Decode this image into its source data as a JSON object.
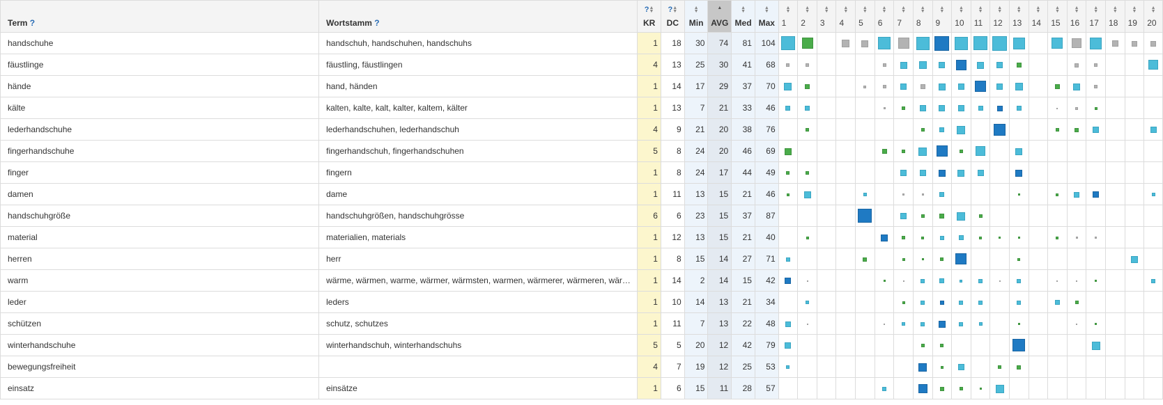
{
  "headers": {
    "term": "Term",
    "stem": "Wortstamm",
    "help": "?",
    "kr": "KR",
    "dc": "DC",
    "min": "Min",
    "avg": "AVG",
    "med": "Med",
    "max": "Max",
    "positions": [
      "1",
      "2",
      "3",
      "4",
      "5",
      "6",
      "7",
      "8",
      "9",
      "10",
      "11",
      "12",
      "13",
      "14",
      "15",
      "16",
      "17",
      "18",
      "19",
      "20"
    ]
  },
  "colors": {
    "gray": "#b3b3b3",
    "green": "#4aac4a",
    "light": "#4cbcd9",
    "dark": "#1f7ac3",
    "kr_bg": "#fcf6cd",
    "stat_bg": "#edf4fb"
  },
  "rows": [
    {
      "term": "handschuhe",
      "stem": "handschuh, handschuhen, handschuhs",
      "kr": "1",
      "dc": "18",
      "min": "30",
      "avg": "74",
      "med": "81",
      "max": "104",
      "cells": [
        [
          "light",
          20
        ],
        [
          "green",
          16
        ],
        null,
        [
          "gray",
          11
        ],
        [
          "gray",
          10
        ],
        [
          "light",
          18
        ],
        [
          "gray",
          16
        ],
        [
          "light",
          19
        ],
        [
          "dark",
          21
        ],
        [
          "light",
          19
        ],
        [
          "light",
          20
        ],
        [
          "light",
          21
        ],
        [
          "light",
          17
        ],
        null,
        [
          "light",
          16
        ],
        [
          "gray",
          14
        ],
        [
          "light",
          17
        ],
        [
          "gray",
          9
        ],
        [
          "gray",
          8
        ],
        [
          "gray",
          8
        ]
      ]
    },
    {
      "term": "fäustlinge",
      "stem": "fäustling, fäustlingen",
      "kr": "4",
      "dc": "13",
      "min": "25",
      "avg": "30",
      "med": "41",
      "max": "68",
      "cells": [
        [
          "gray",
          5
        ],
        [
          "gray",
          5
        ],
        null,
        null,
        null,
        [
          "gray",
          5
        ],
        [
          "light",
          10
        ],
        [
          "light",
          11
        ],
        [
          "light",
          9
        ],
        [
          "dark",
          15
        ],
        [
          "light",
          10
        ],
        [
          "light",
          9
        ],
        [
          "green",
          7
        ],
        null,
        null,
        [
          "gray",
          6
        ],
        [
          "gray",
          5
        ],
        null,
        null,
        [
          "light",
          14
        ]
      ]
    },
    {
      "term": "hände",
      "stem": "hand, händen",
      "kr": "1",
      "dc": "14",
      "min": "17",
      "avg": "29",
      "med": "37",
      "max": "70",
      "cells": [
        [
          "light",
          11
        ],
        [
          "green",
          7
        ],
        null,
        null,
        [
          "gray",
          4
        ],
        [
          "gray",
          5
        ],
        [
          "light",
          9
        ],
        [
          "gray",
          7
        ],
        [
          "light",
          10
        ],
        [
          "light",
          9
        ],
        [
          "dark",
          16
        ],
        [
          "light",
          9
        ],
        [
          "light",
          11
        ],
        null,
        [
          "green",
          7
        ],
        [
          "light",
          10
        ],
        [
          "gray",
          5
        ],
        null,
        null,
        null
      ]
    },
    {
      "term": "kälte",
      "stem": "kalten, kalte, kalt, kalter, kaltem, kälter",
      "kr": "1",
      "dc": "13",
      "min": "7",
      "avg": "21",
      "med": "33",
      "max": "46",
      "cells": [
        [
          "light",
          7
        ],
        [
          "light",
          7
        ],
        null,
        null,
        null,
        [
          "gray",
          3
        ],
        [
          "green",
          5
        ],
        [
          "light",
          9
        ],
        [
          "light",
          9
        ],
        [
          "light",
          9
        ],
        [
          "light",
          7
        ],
        [
          "dark",
          8
        ],
        [
          "light",
          7
        ],
        null,
        [
          "gray",
          2
        ],
        [
          "gray",
          4
        ],
        [
          "green",
          4
        ],
        null,
        null,
        null
      ]
    },
    {
      "term": "lederhandschuhe",
      "stem": "lederhandschuhen, lederhandschuh",
      "kr": "4",
      "dc": "9",
      "min": "21",
      "avg": "20",
      "med": "38",
      "max": "76",
      "cells": [
        null,
        [
          "green",
          5
        ],
        null,
        null,
        null,
        null,
        null,
        [
          "green",
          5
        ],
        [
          "light",
          7
        ],
        [
          "light",
          12
        ],
        null,
        [
          "dark",
          17
        ],
        null,
        null,
        [
          "green",
          5
        ],
        [
          "green",
          6
        ],
        [
          "light",
          9
        ],
        null,
        null,
        [
          "light",
          9
        ]
      ]
    },
    {
      "term": "fingerhandschuhe",
      "stem": "fingerhandschuh, fingerhandschuhen",
      "kr": "5",
      "dc": "8",
      "min": "24",
      "avg": "20",
      "med": "46",
      "max": "69",
      "cells": [
        [
          "green",
          10
        ],
        null,
        null,
        null,
        null,
        [
          "green",
          7
        ],
        [
          "green",
          5
        ],
        [
          "light",
          12
        ],
        [
          "dark",
          16
        ],
        [
          "green",
          5
        ],
        [
          "light",
          14
        ],
        null,
        [
          "light",
          10
        ],
        null,
        null,
        null,
        null,
        null,
        null,
        null
      ]
    },
    {
      "term": "finger",
      "stem": "fingern",
      "kr": "1",
      "dc": "8",
      "min": "24",
      "avg": "17",
      "med": "44",
      "max": "49",
      "cells": [
        [
          "green",
          5
        ],
        [
          "green",
          5
        ],
        null,
        null,
        null,
        null,
        [
          "light",
          9
        ],
        [
          "light",
          9
        ],
        [
          "dark",
          10
        ],
        [
          "light",
          10
        ],
        [
          "light",
          9
        ],
        null,
        [
          "dark",
          10
        ],
        null,
        null,
        null,
        null,
        null,
        null,
        null
      ]
    },
    {
      "term": "damen",
      "stem": "dame",
      "kr": "1",
      "dc": "11",
      "min": "13",
      "avg": "15",
      "med": "21",
      "max": "46",
      "cells": [
        [
          "green",
          4
        ],
        [
          "light",
          10
        ],
        null,
        null,
        [
          "light",
          5
        ],
        null,
        [
          "gray",
          3
        ],
        [
          "gray",
          3
        ],
        [
          "light",
          7
        ],
        null,
        null,
        null,
        [
          "green",
          3
        ],
        null,
        [
          "green",
          4
        ],
        [
          "light",
          8
        ],
        [
          "dark",
          9
        ],
        null,
        null,
        [
          "light",
          5
        ]
      ]
    },
    {
      "term": "handschuhgröße",
      "stem": "handschuhgrößen, handschuhgrösse",
      "kr": "6",
      "dc": "6",
      "min": "23",
      "avg": "15",
      "med": "37",
      "max": "87",
      "cells": [
        null,
        null,
        null,
        null,
        [
          "dark",
          20
        ],
        null,
        [
          "light",
          9
        ],
        [
          "green",
          5
        ],
        [
          "green",
          7
        ],
        [
          "light",
          12
        ],
        [
          "green",
          5
        ],
        null,
        null,
        null,
        null,
        null,
        null,
        null,
        null,
        null
      ]
    },
    {
      "term": "material",
      "stem": "materialien, materials",
      "kr": "1",
      "dc": "12",
      "min": "13",
      "avg": "15",
      "med": "21",
      "max": "40",
      "cells": [
        null,
        [
          "green",
          4
        ],
        null,
        null,
        null,
        [
          "dark",
          10
        ],
        [
          "green",
          5
        ],
        [
          "green",
          4
        ],
        [
          "light",
          6
        ],
        [
          "light",
          7
        ],
        [
          "green",
          4
        ],
        [
          "green",
          3
        ],
        [
          "green",
          3
        ],
        null,
        [
          "green",
          4
        ],
        [
          "gray",
          3
        ],
        [
          "gray",
          3
        ],
        null,
        null,
        null
      ]
    },
    {
      "term": "herren",
      "stem": "herr",
      "kr": "1",
      "dc": "8",
      "min": "15",
      "avg": "14",
      "med": "27",
      "max": "71",
      "cells": [
        [
          "light",
          6
        ],
        null,
        null,
        null,
        [
          "green",
          6
        ],
        null,
        [
          "green",
          4
        ],
        [
          "green",
          3
        ],
        [
          "green",
          5
        ],
        [
          "dark",
          16
        ],
        null,
        null,
        [
          "green",
          4
        ],
        null,
        null,
        null,
        null,
        null,
        [
          "light",
          10
        ],
        null
      ]
    },
    {
      "term": "warm",
      "stem": "wärme, wärmen, warme, wärmer, wärmsten, warmen, wärmerer, wärmeren, wärmste",
      "kr": "1",
      "dc": "14",
      "min": "2",
      "avg": "14",
      "med": "15",
      "max": "42",
      "cells": [
        [
          "dark",
          9
        ],
        [
          "gray",
          1
        ],
        null,
        null,
        null,
        [
          "green",
          3
        ],
        [
          "gray",
          1
        ],
        [
          "light",
          6
        ],
        [
          "light",
          7
        ],
        [
          "light",
          4
        ],
        [
          "light",
          6
        ],
        [
          "gray",
          1
        ],
        [
          "light",
          6
        ],
        null,
        [
          "gray",
          2
        ],
        [
          "gray",
          1
        ],
        [
          "green",
          3
        ],
        null,
        null,
        [
          "light",
          6
        ]
      ]
    },
    {
      "term": "leder",
      "stem": "leders",
      "kr": "1",
      "dc": "10",
      "min": "14",
      "avg": "13",
      "med": "21",
      "max": "34",
      "cells": [
        null,
        [
          "light",
          5
        ],
        null,
        null,
        null,
        null,
        [
          "green",
          4
        ],
        [
          "light",
          6
        ],
        [
          "dark",
          6
        ],
        [
          "light",
          6
        ],
        [
          "light",
          6
        ],
        null,
        [
          "light",
          6
        ],
        null,
        [
          "light",
          7
        ],
        [
          "green",
          5
        ],
        null,
        null,
        null,
        null
      ]
    },
    {
      "term": "schützen",
      "stem": "schutz, schutzes",
      "kr": "1",
      "dc": "11",
      "min": "7",
      "avg": "13",
      "med": "22",
      "max": "48",
      "cells": [
        [
          "light",
          8
        ],
        [
          "gray",
          1
        ],
        null,
        null,
        null,
        [
          "gray",
          1
        ],
        [
          "light",
          5
        ],
        [
          "light",
          6
        ],
        [
          "dark",
          10
        ],
        [
          "light",
          6
        ],
        [
          "light",
          5
        ],
        null,
        [
          "green",
          3
        ],
        null,
        null,
        [
          "gray",
          2
        ],
        [
          "green",
          3
        ],
        null,
        null,
        null
      ]
    },
    {
      "term": "winterhandschuhe",
      "stem": "winterhandschuh, winterhandschuhs",
      "kr": "5",
      "dc": "5",
      "min": "20",
      "avg": "12",
      "med": "42",
      "max": "79",
      "cells": [
        [
          "light",
          9
        ],
        null,
        null,
        null,
        null,
        null,
        null,
        [
          "green",
          5
        ],
        [
          "green",
          5
        ],
        null,
        null,
        null,
        [
          "dark",
          18
        ],
        null,
        null,
        null,
        [
          "light",
          12
        ],
        null,
        null,
        null
      ]
    },
    {
      "term": "bewegungsfreiheit",
      "stem": "",
      "kr": "4",
      "dc": "7",
      "min": "19",
      "avg": "12",
      "med": "25",
      "max": "53",
      "cells": [
        [
          "light",
          5
        ],
        null,
        null,
        null,
        null,
        null,
        null,
        [
          "dark",
          12
        ],
        [
          "green",
          4
        ],
        [
          "light",
          9
        ],
        null,
        [
          "green",
          5
        ],
        [
          "green",
          6
        ],
        null,
        null,
        null,
        null,
        null,
        null,
        null
      ]
    },
    {
      "term": "einsatz",
      "stem": "einsätze",
      "kr": "1",
      "dc": "6",
      "min": "15",
      "avg": "11",
      "med": "28",
      "max": "57",
      "cells": [
        null,
        null,
        null,
        null,
        null,
        [
          "light",
          6
        ],
        null,
        [
          "dark",
          13
        ],
        [
          "green",
          6
        ],
        [
          "green",
          5
        ],
        [
          "green",
          3
        ],
        [
          "light",
          12
        ],
        null,
        null,
        null,
        null,
        null,
        null,
        null,
        null
      ]
    }
  ]
}
